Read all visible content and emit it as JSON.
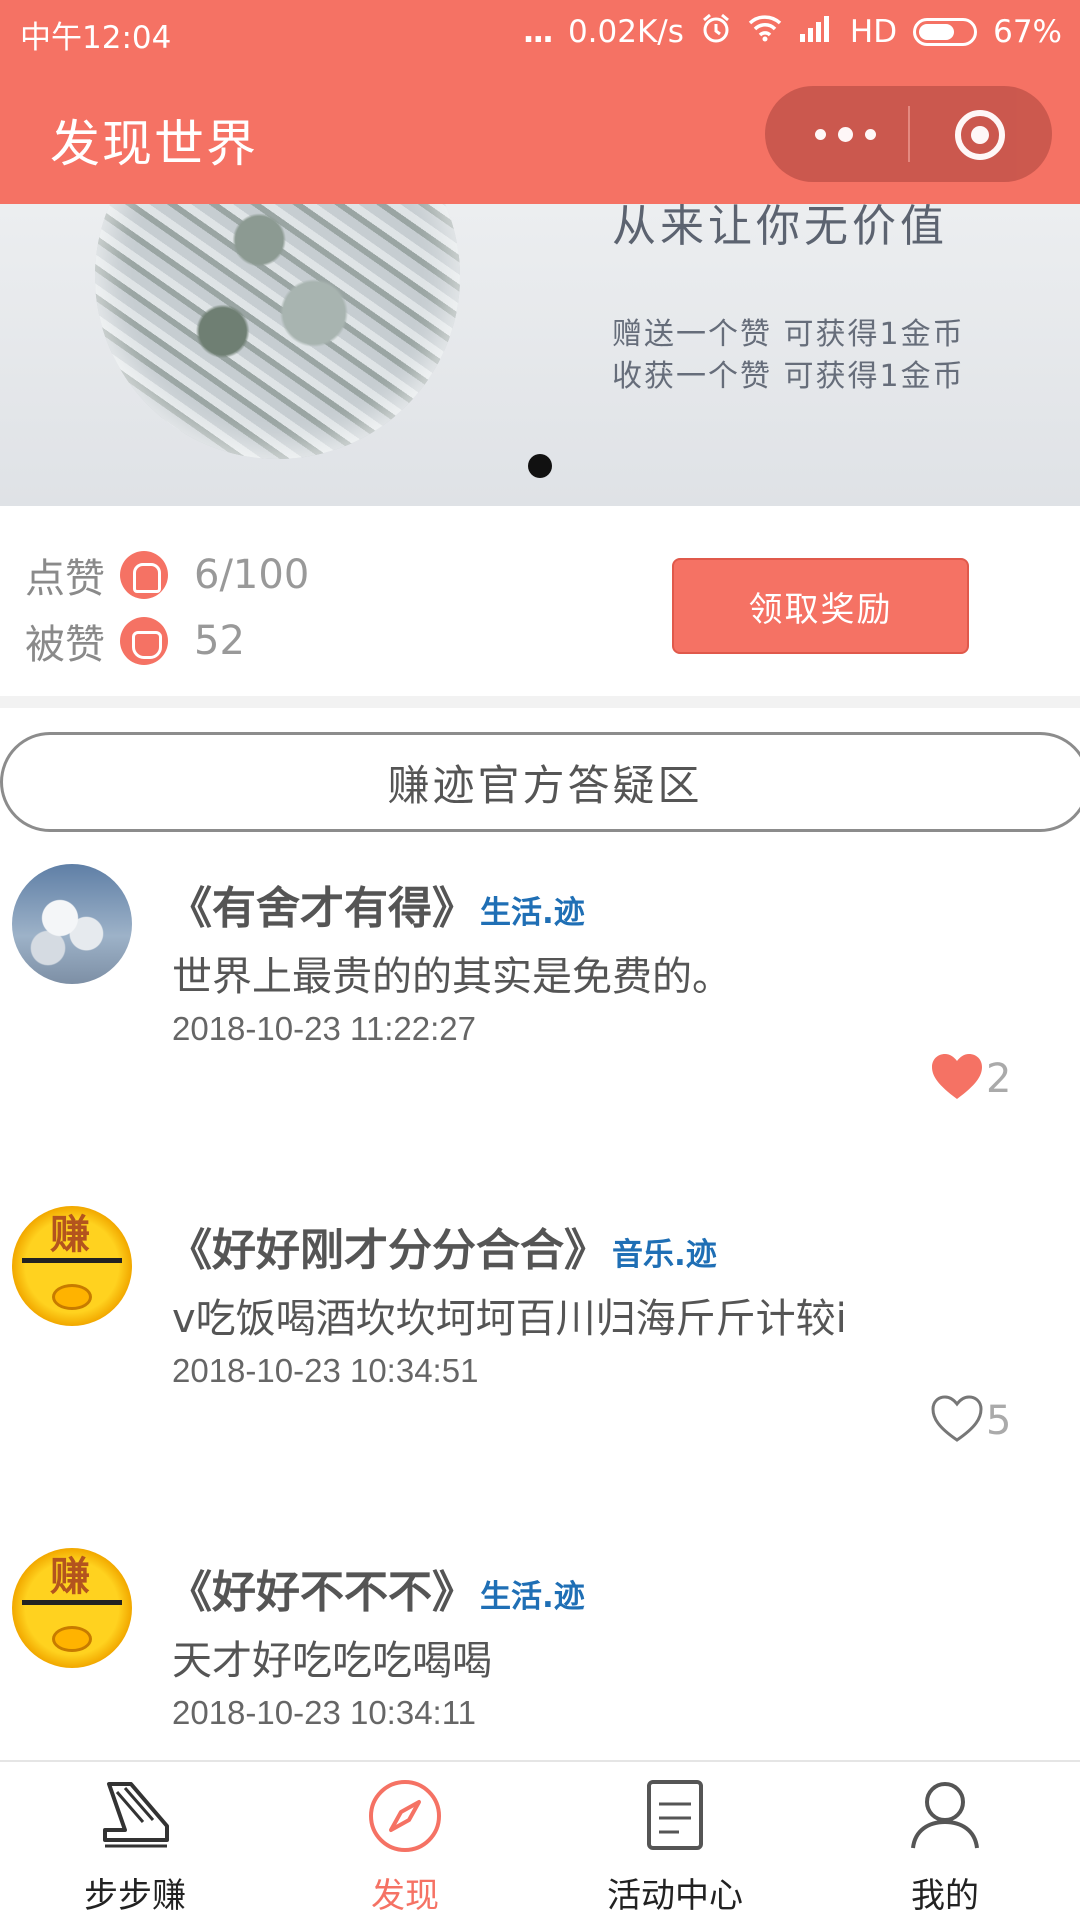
{
  "status_bar": {
    "time": "中午12:04",
    "dots": "...",
    "network_speed": "0.02K/s",
    "network_type": "HD",
    "battery_percent": "67%",
    "battery_level": 0.67
  },
  "header": {
    "title": "发现世界"
  },
  "banner": {
    "headline": "从来让你无价值",
    "line1": "赠送一个赞  可获得1金币",
    "line2": "收获一个赞  可获得1金币"
  },
  "stats": {
    "like_label": "点赞",
    "like_value": "6/100",
    "liked_label": "被赞",
    "liked_value": "52",
    "claim_button": "领取奖励"
  },
  "qa_button": "赚迹官方答疑区",
  "posts": [
    {
      "title": "《有舍才有得》",
      "category": "生活.迹",
      "body": "世界上最贵的的其实是免费的。",
      "date": "2018-10-23 11:22:27",
      "likes": "2",
      "liked": true
    },
    {
      "title": "《好好刚才分分合合》",
      "category": "音乐.迹",
      "body": "v吃饭喝酒坎坎坷坷百川归海斤斤计较i",
      "date": "2018-10-23 10:34:51",
      "likes": "5",
      "liked": false
    },
    {
      "title": "《好好不不不》",
      "category": "生活.迹",
      "body": "天才好吃吃吃喝喝",
      "date": "2018-10-23 10:34:11",
      "likes": "",
      "liked": false
    }
  ],
  "bottom_nav": [
    {
      "label": "步步赚",
      "icon": "shoe-icon",
      "active": false
    },
    {
      "label": "发现",
      "icon": "compass-icon",
      "active": true
    },
    {
      "label": "活动中心",
      "icon": "document-icon",
      "active": false
    },
    {
      "label": "我的",
      "icon": "user-icon",
      "active": false
    }
  ],
  "colors": {
    "brand": "#f57264",
    "category_link": "#1f6fb5",
    "like_active": "#f57264",
    "like_inactive": "#aaaaaa"
  }
}
